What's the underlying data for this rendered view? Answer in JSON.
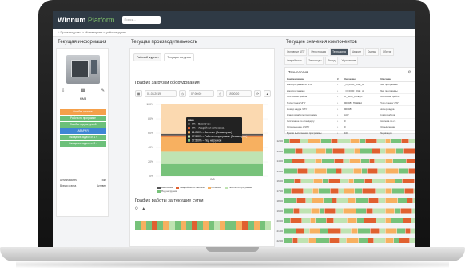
{
  "app": {
    "logo_main": "Winnum ",
    "logo_accent": "Platform",
    "search_placeholder": "Поиск...",
    "breadcrumb": "⌂  Производство > Мониторинг и учёт загрузки"
  },
  "panels": {
    "left_title": "Текущая информация",
    "middle_title": "Текущая производительность",
    "right_title": "Текущие значения компонентов"
  },
  "left": {
    "machine_label": "НМ3",
    "icons": [
      "⇩",
      "▦",
      "✎"
    ],
    "statuses": [
      {
        "label": "Ошибка системы",
        "color": "#f5a04a"
      },
      {
        "label": "Работа по программе",
        "color": "#6cc07a"
      },
      {
        "label": "Ошибка под загрузкой",
        "color": "#6cc07a"
      },
      {
        "label": "АВАРИЯ",
        "color": "#3f86d4"
      },
      {
        "label": "Ожидание задачи от 1 ч",
        "color": "#6cc07a"
      },
      {
        "label": "Ожидание задачи от 2 ч",
        "color": "#6cc07a"
      }
    ],
    "footer": [
      {
        "name": "Активна смена",
        "value": "Вкл"
      },
      {
        "name": "Время станка",
        "value": "Активен"
      }
    ]
  },
  "middle": {
    "tabs": [
      "Рабочий журнал",
      "Текущая загрузка"
    ],
    "chart_title": "График загрузки оборудования",
    "date_from": "01.03.2019",
    "time_from": "07:00:00",
    "time_to": "19:00:00",
    "shift_title": "График работы за текущие сутки",
    "shift_icons": [
      "⟳",
      "▲"
    ]
  },
  "chart_data": {
    "type": "bar",
    "categories": [
      "НМ3"
    ],
    "ylim": [
      0,
      100
    ],
    "y_ticks": [
      "100%",
      "80%",
      "60%",
      "40%",
      "20%",
      "0%"
    ],
    "series": [
      {
        "name": "Выключен",
        "values": [
          2
        ],
        "color": "#555555"
      },
      {
        "name": "Аварийная остановка",
        "values": [
          2
        ],
        "color": "#e06030"
      },
      {
        "name": "Включен (без загрузки)",
        "values": [
          21
        ],
        "color": "#f7b060"
      },
      {
        "name": "Работа по программе (без загрузки)",
        "values": [
          17
        ],
        "color": "#bfe3b2"
      },
      {
        "name": "Под нагрузкой",
        "values": [
          17
        ],
        "color": "#77c27a"
      }
    ],
    "tooltip": {
      "title": "НМ3",
      "lines": [
        "0% – Выключен",
        "0% – Аварийная остановка",
        "21.250% – Включен (без загрузки)",
        "17.500% – Работа по программе (без загрузки)",
        "17.500% – Под нагрузкой"
      ]
    },
    "legend": [
      "Выключен",
      "Аварийная остановка",
      "Включен",
      "Работа по программе",
      "Под нагрузкой"
    ]
  },
  "right": {
    "tabs": [
      {
        "label": "Основные ЧПУ",
        "active": false
      },
      {
        "label": "Регистрация",
        "active": false
      },
      {
        "label": "Технология",
        "active": true
      },
      {
        "label": "Аварии",
        "active": false
      },
      {
        "label": "Оценки",
        "active": false
      },
      {
        "label": "Сбытие",
        "active": false
      },
      {
        "label": "Аварийность",
        "active": false
      },
      {
        "label": "Электроды",
        "active": false
      },
      {
        "label": "Вклад",
        "active": false
      },
      {
        "label": "Управление",
        "active": false
      }
    ],
    "table_title": "Технология",
    "table_headers": [
      "Наименование",
      "#",
      "Значение",
      "Описание"
    ],
    "table_rows": [
      [
        "Имя программы в ЧПУ",
        "↓",
        "_O_0000_DGE_A",
        "Имя программы"
      ],
      [
        "Имя программы",
        "↓",
        "_O_0000_DGE_A",
        "Имя программы"
      ],
      [
        "Состояние файла",
        "↓",
        "O_0000_DGE_B",
        "Состояние файла"
      ],
      [
        "Пуск станка ЧПУ",
        "↓",
        "900087 ПУЩЕН",
        "Пуск станка ЧПУ"
      ],
      [
        "Номер кадра ЧПУ",
        "↓",
        "900087",
        "Номер кадра"
      ],
      [
        "Кладр в работе программы",
        "↓",
        "AUT",
        "Кладр работа"
      ],
      [
        "Системное по стандарту",
        "↓",
        "0",
        "Система по ст."
      ],
      [
        "Определение с ЧПУ",
        "↓",
        "0",
        "Определение"
      ],
      [
        "Время выполнения программы",
        "↓",
        "100",
        "Индикация"
      ]
    ],
    "timeline_times": [
      "12:00",
      "13:00",
      "14:00",
      "15:00",
      "16:00",
      "17:00",
      "18:00",
      "19:00",
      "20:00",
      "21:00",
      "22:00",
      "23:00"
    ]
  }
}
